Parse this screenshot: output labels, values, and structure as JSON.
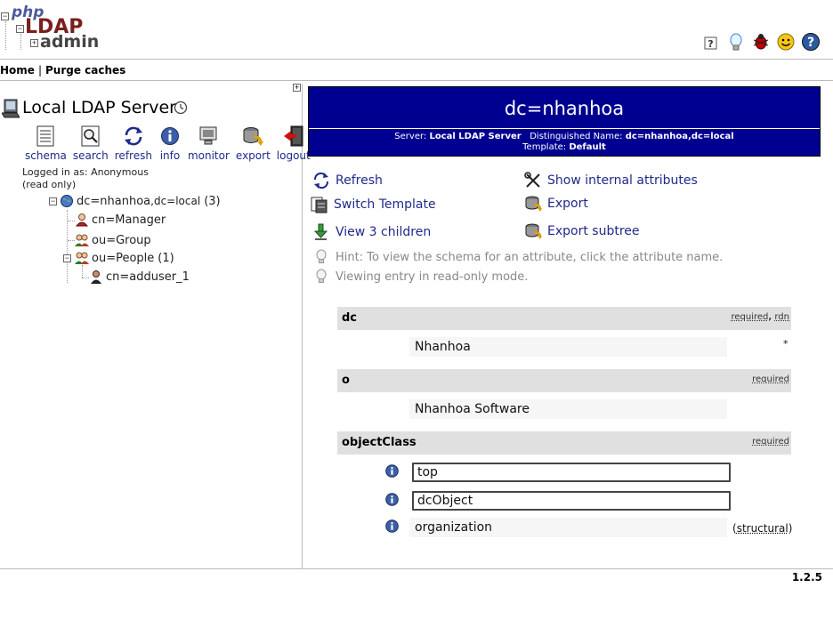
{
  "logo": {
    "php": "php",
    "ldap": "LDAP",
    "admin": "admin"
  },
  "header_icons": [
    "help-icon",
    "lightbulb-icon",
    "bug-icon",
    "smiley-icon",
    "question-icon"
  ],
  "topnav": {
    "home": "Home",
    "separator": "|",
    "purge": "Purge caches"
  },
  "server": {
    "title": "Local LDAP Server",
    "logged_in_line": "Logged in as: Anonymous",
    "read_only_line": "(read only)"
  },
  "tools": [
    {
      "label": "schema",
      "icon": "schema-icon"
    },
    {
      "label": "search",
      "icon": "search-icon"
    },
    {
      "label": "refresh",
      "icon": "refresh-icon"
    },
    {
      "label": "info",
      "icon": "info-icon"
    },
    {
      "label": "monitor",
      "icon": "monitor-icon"
    },
    {
      "label": "export",
      "icon": "export-icon"
    },
    {
      "label": "logout",
      "icon": "logout-icon"
    }
  ],
  "tree": {
    "root": {
      "dn": "dc=nhanhoa",
      "suffix": ",dc=local",
      "count": "(3)"
    },
    "children": [
      {
        "label": "cn=Manager",
        "icon": "user-icon"
      },
      {
        "label": "ou=Group",
        "icon": "group-icon"
      },
      {
        "label": "ou=People",
        "count": "(1)",
        "icon": "group-icon"
      },
      {
        "label": "cn=adduser_1",
        "icon": "user-icon"
      }
    ]
  },
  "entry": {
    "dn_title": "dc=nhanhoa",
    "server_label": "Server:",
    "server_value": "Local LDAP Server",
    "dn_label": "Distinguished Name:",
    "dn_value": "dc=nhanhoa,dc=local",
    "template_label": "Template:",
    "template_value": "Default"
  },
  "actions": {
    "refresh": "Refresh",
    "show_internal": "Show internal attributes",
    "switch_template": "Switch Template",
    "export": "Export",
    "view_children": "View 3 children",
    "export_subtree": "Export subtree"
  },
  "hints": {
    "schema_hint": "Hint: To view the schema for an attribute, click the attribute name.",
    "readonly_hint": "Viewing entry in read-only mode."
  },
  "attributes": {
    "dc": {
      "name": "dc",
      "flag1": "required",
      "flag_sep": ",",
      "flag2": "rdn",
      "value": "Nhanhoa",
      "marker": "*"
    },
    "o": {
      "name": "o",
      "flag": "required",
      "value": "Nhanhoa Software"
    },
    "objectClass": {
      "name": "objectClass",
      "flag": "required",
      "values": [
        "top",
        "dcObject",
        "organization"
      ],
      "structural_open": "(",
      "structural": "structural",
      "structural_close": ")"
    }
  },
  "version": "1.2.5",
  "colors": {
    "title_bg": "#000090",
    "link": "#1f2a8a",
    "attr_head_bg": "#e0e0e0"
  }
}
